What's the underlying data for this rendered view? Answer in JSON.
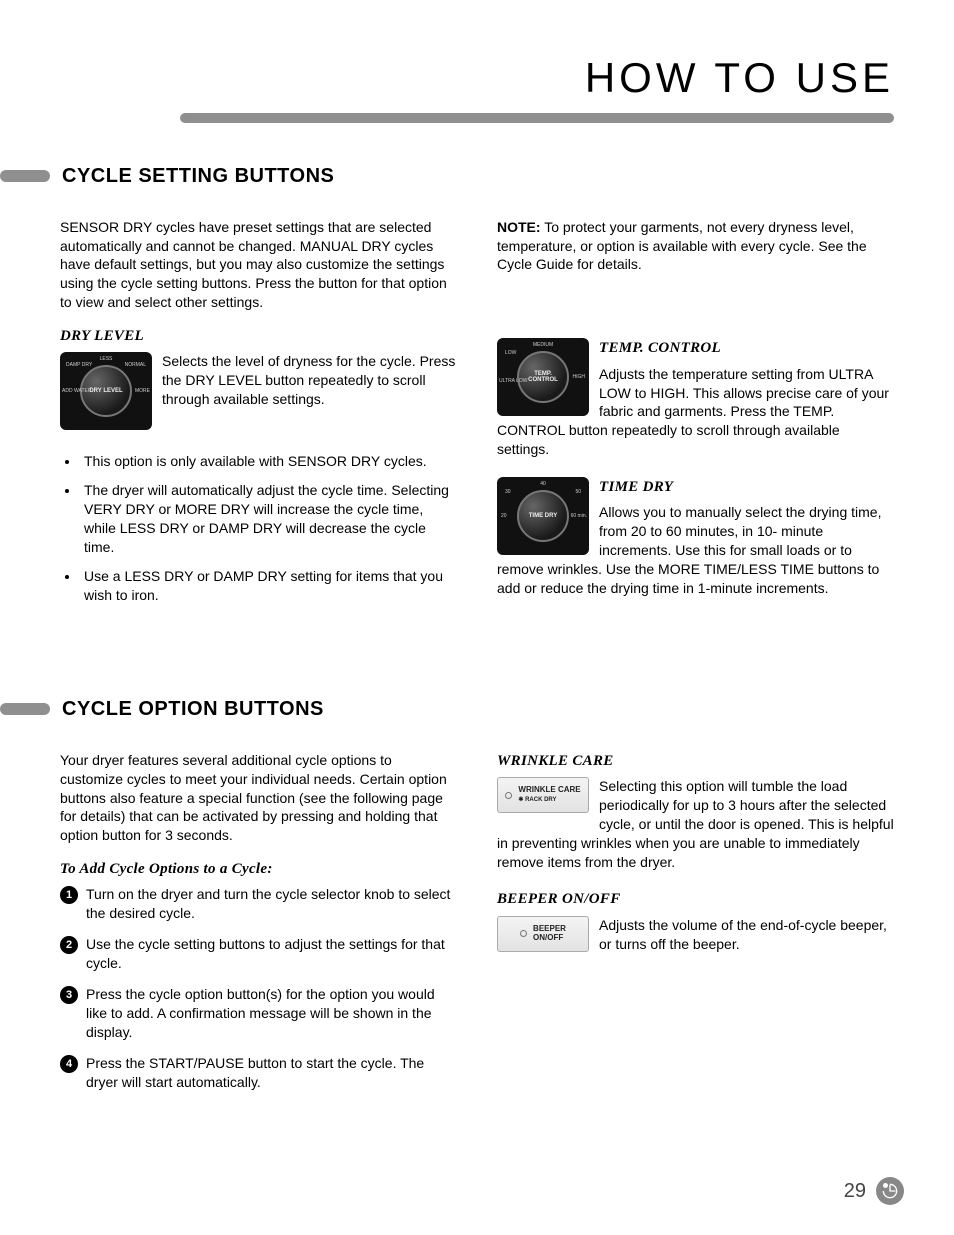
{
  "page": {
    "title": "HOW TO USE",
    "number": "29"
  },
  "section1": {
    "heading": "CYCLE SETTING BUTTONS",
    "intro": "SENSOR DRY cycles have preset settings that are selected automatically and cannot be changed. MANUAL DRY cycles have default settings, but you may also customize the settings using the cycle setting buttons. Press the button for that option to view and select other settings.",
    "note_prefix": "NOTE:",
    "note_body": " To protect your garments, not every dryness level, temperature, or option is available with every cycle. See the Cycle Guide for details.",
    "dry_level": {
      "h": "DRY LEVEL",
      "dial_label": "DRY LEVEL",
      "labels": {
        "top": "LESS",
        "tl": "DAMP DRY",
        "left": "ADD WATER",
        "right": "MORE",
        "tr": "NORMAL"
      },
      "body": "Selects the level of dryness for the cycle. Press the DRY LEVEL button repeatedly to scroll through available settings.",
      "bullets": [
        "This option is only available with SENSOR DRY cycles.",
        "The dryer will automatically adjust the cycle time. Selecting VERY DRY or MORE DRY will increase the cycle time, while LESS DRY or DAMP DRY will decrease the cycle time.",
        "Use a LESS DRY or DAMP DRY setting for items that you wish to iron."
      ]
    },
    "temp_control": {
      "h": "TEMP. CONTROL",
      "dial_label": "TEMP. CONTROL",
      "labels": {
        "top": "MEDIUM",
        "tl": "LOW",
        "left": "ULTRA LOW",
        "right": "HIGH"
      },
      "body": "Adjusts the temperature setting from ULTRA LOW to HIGH. This allows precise care of your fabric and garments. Press the TEMP. CONTROL button repeatedly to scroll through available settings."
    },
    "time_dry": {
      "h": "TIME DRY",
      "dial_label": "TIME DRY",
      "labels": {
        "top": "40",
        "tl": "30",
        "left": "20",
        "tr": "50",
        "right": "60 min."
      },
      "body": "Allows you to manually select the drying time, from 20 to 60 minutes, in 10- minute increments. Use this for small loads or to remove wrinkles. Use the MORE TIME/LESS TIME buttons to add or reduce the drying time in 1-minute increments."
    }
  },
  "section2": {
    "heading": "CYCLE OPTION BUTTONS",
    "intro": "Your dryer features several additional cycle options to customize cycles to meet your individual needs. Certain option buttons also feature a special function (see the following page for details) that can be activated by pressing and holding that option button for 3 seconds.",
    "steps_h": "To Add Cycle Options to a Cycle:",
    "steps": [
      "Turn on the dryer and turn the cycle selector knob to select the desired cycle.",
      "Use the cycle setting buttons to adjust the settings for that cycle.",
      "Press the cycle option button(s) for the option you would like to add. A confirmation message will be shown in the display.",
      "Press the START/PAUSE button to start the cycle. The dryer will start automatically."
    ],
    "wrinkle": {
      "h": "WRINKLE CARE",
      "btn_line1": "WRINKLE CARE",
      "btn_line2": "✱ RACK DRY",
      "body": "Selecting this option will tumble the load periodically for up to 3 hours after the selected cycle, or until the door is opened. This is helpful in preventing wrinkles when you are unable to immediately remove items from the dryer."
    },
    "beeper": {
      "h": "BEEPER ON/OFF",
      "btn_line1": "BEEPER",
      "btn_line2": "ON/OFF",
      "body": "Adjusts the volume of the end-of-cycle beeper, or turns off the beeper."
    }
  }
}
